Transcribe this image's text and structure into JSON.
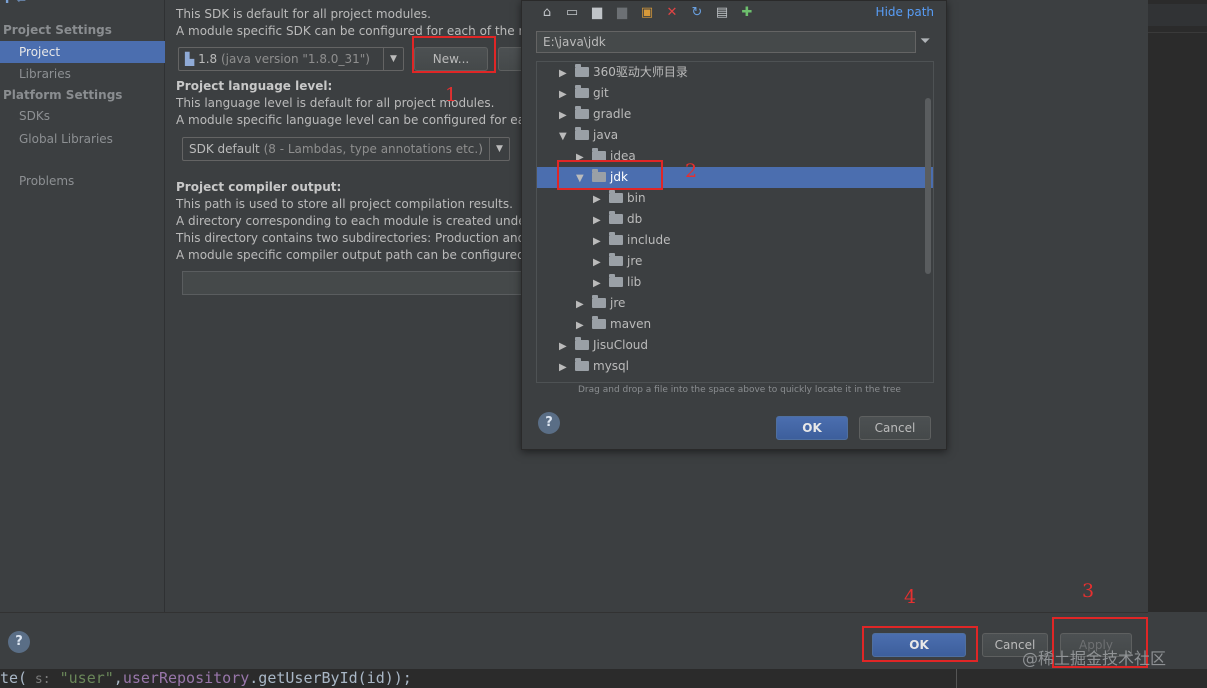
{
  "sidebar": {
    "header_project": "Project Settings",
    "item_project": "Project",
    "item_libraries": "Libraries",
    "header_platform": "Platform Settings",
    "item_sdks": "SDKs",
    "item_global_libraries": "Global Libraries",
    "item_problems": "Problems"
  },
  "main": {
    "sdk_desc1": "This SDK is default for all project modules.",
    "sdk_desc2": "A module specific SDK can be configured for each of the m",
    "sdk_value": "1.8",
    "sdk_value_detail": "(java version \"1.8.0_31\")",
    "new_button": "New...",
    "lang_title": "Project language level:",
    "lang_desc1": "This language level is default for all project modules.",
    "lang_desc2": "A module specific language level can be configured for eac",
    "lang_value": "SDK default",
    "lang_value_detail": "(8 - Lambdas, type annotations etc.)",
    "compiler_title": "Project compiler output:",
    "compiler_desc1": "This path is used to store all project compilation results.",
    "compiler_desc2": "A directory corresponding to each module is created under",
    "compiler_desc3": "This directory contains two subdirectories: Production and T",
    "compiler_desc4": "A module specific compiler output path can be configured"
  },
  "dialog": {
    "hide_path": "Hide path",
    "path_value": "E:\\java\\jdk",
    "tree": [
      {
        "label": "360驱动大师目录",
        "depth": 0,
        "expanded": false
      },
      {
        "label": "git",
        "depth": 0,
        "expanded": false
      },
      {
        "label": "gradle",
        "depth": 0,
        "expanded": false
      },
      {
        "label": "java",
        "depth": 0,
        "expanded": true
      },
      {
        "label": "idea",
        "depth": 1,
        "expanded": false
      },
      {
        "label": "jdk",
        "depth": 1,
        "expanded": true,
        "selected": true
      },
      {
        "label": "bin",
        "depth": 2,
        "expanded": false
      },
      {
        "label": "db",
        "depth": 2,
        "expanded": false
      },
      {
        "label": "include",
        "depth": 2,
        "expanded": false
      },
      {
        "label": "jre",
        "depth": 2,
        "expanded": false
      },
      {
        "label": "lib",
        "depth": 2,
        "expanded": false
      },
      {
        "label": "jre",
        "depth": 1,
        "expanded": false
      },
      {
        "label": "maven",
        "depth": 1,
        "expanded": false
      },
      {
        "label": "JisuCloud",
        "depth": 0,
        "expanded": false
      },
      {
        "label": "mysql",
        "depth": 0,
        "expanded": false
      }
    ],
    "drag_hint": "Drag and drop a file into the space above to quickly locate it in the tree",
    "ok": "OK",
    "cancel": "Cancel",
    "help": "?"
  },
  "footer": {
    "ok": "OK",
    "cancel": "Cancel",
    "apply": "Apply",
    "help": "?"
  },
  "annotations": {
    "n1": "1",
    "n2": "2",
    "n3": "3",
    "n4": "4",
    "color": "#e02626"
  },
  "code": {
    "prefix": "te(",
    "hint": " s:",
    "str": " \"user\"",
    "rest1": ",",
    "fn": "userRepository",
    "rest2": ".getUserById(id));"
  },
  "watermark": "@稀土掘金技术社区"
}
